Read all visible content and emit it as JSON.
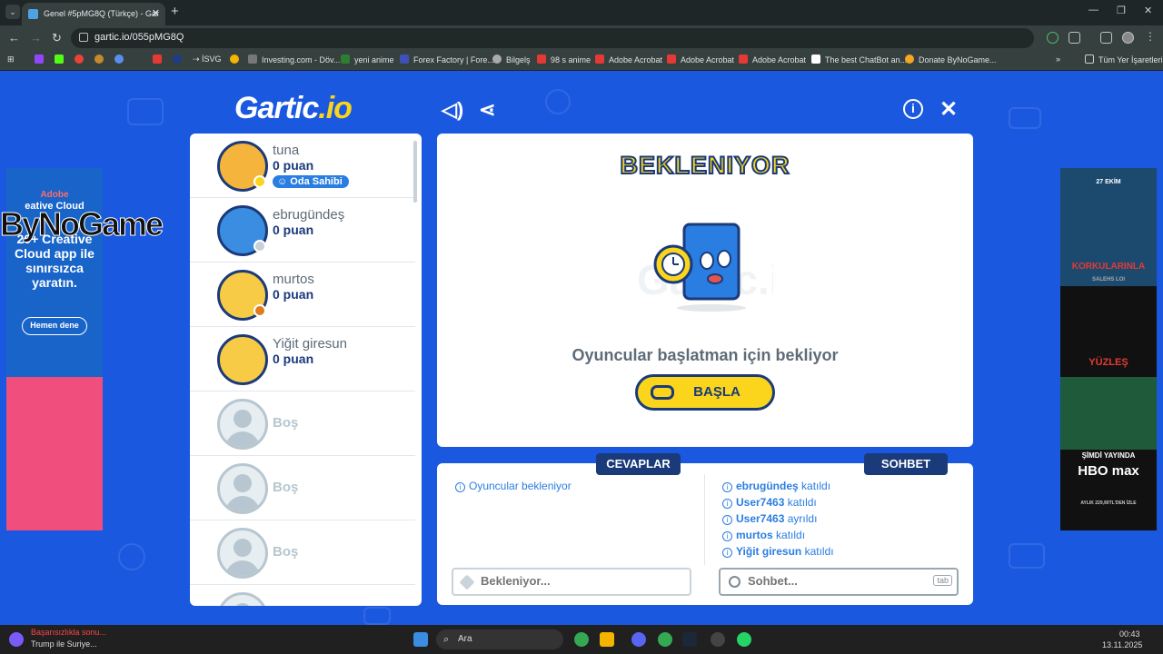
{
  "browser": {
    "tab_title": "Genel #5pMG8Q (Türkçe) - Gar",
    "url": "gartic.io/055pMG8Q",
    "bookmarks": [
      "İSVG",
      "Investing.com - Döv...",
      "yeni anime",
      "Forex Factory | Fore...",
      "Bilgelş",
      "98 s anime",
      "Adobe Acrobat",
      "Adobe Acrobat",
      "Adobe Acrobat",
      "The best ChatBot an...",
      "Donate ByNoGame...",
      "Tüm Yer İşaretleri"
    ]
  },
  "logo": {
    "text": "Gartic",
    "suffix": ".io"
  },
  "players": [
    {
      "name": "tuna",
      "points": "0 puan",
      "badge": "Oda Sahibi",
      "color": "#f5b43c",
      "status": "#fbd51c"
    },
    {
      "name": "ebrugündeş",
      "points": "0 puan",
      "color": "#3a8de0",
      "status": "#c9d0d6"
    },
    {
      "name": "murtos",
      "points": "0 puan",
      "color": "#f7cb45",
      "status": "#e07a1a"
    },
    {
      "name": "Yiğit giresun",
      "points": "0 puan",
      "color": "#f7cb45"
    }
  ],
  "empty_slot_label": "Boş",
  "stage": {
    "title": "BEKLENIYOR",
    "waiting_text": "Oyuncular başlatman için bekliyor",
    "start_button": "BAŞLA"
  },
  "answers": {
    "tab": "CEVAPLAR",
    "message": "Oyuncular bekleniyor",
    "placeholder": "Bekleniyor..."
  },
  "chat": {
    "tab": "SOHBET",
    "messages": [
      {
        "user": "ebrugündeş",
        "action": "katıldı"
      },
      {
        "user": "User7463",
        "action": "katıldı"
      },
      {
        "user": "User7463",
        "action": "ayrıldı"
      },
      {
        "user": "murtos",
        "action": "katıldı"
      },
      {
        "user": "Yiğit giresun",
        "action": "katıldı"
      }
    ],
    "placeholder": "Sohbet...",
    "tab_key": "tab"
  },
  "ads": {
    "left_brand": "Adobe",
    "left_sub": "eative Cloud",
    "left_headline": "20+ Creative Cloud app ile sınırsızca yaratın.",
    "left_button": "Hemen dene",
    "right_top": "27 EKİM",
    "right_movie1": "KORKULARINLA",
    "right_sub1": "SALEHS LOI",
    "right_movie2": "YÜZLEŞ",
    "right_mid": "ŞİMDİ YAYINDA",
    "right_brand": "HBO max",
    "right_price": "AYLIK 229,90TL'DEN İZLE"
  },
  "overlay_watermark": "ByNoGame",
  "taskbar": {
    "news_title": "Trump ile Suriye...",
    "news_head": "Başarısızlıkla sonu...",
    "search": "Ara",
    "time": "00:43",
    "date": "13.11.2025"
  }
}
